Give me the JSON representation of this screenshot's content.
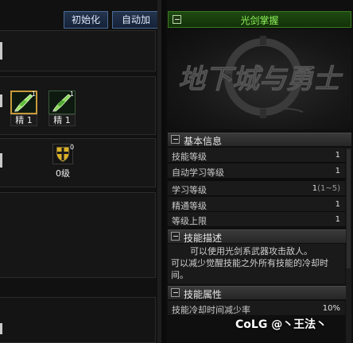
{
  "toolbar": {
    "init_label": "初始化",
    "auto_label": "自动加点"
  },
  "left": {
    "skill_slots": [
      {
        "level_badge": "1",
        "caption": "精 1",
        "icon": "green-sword-skill-icon",
        "selected": true
      },
      {
        "level_badge": "1",
        "caption": "精 1",
        "icon": "green-sword-skill-icon",
        "selected": false
      }
    ],
    "passive_slot": {
      "level_badge": "0",
      "caption": "0级",
      "icon": "shield-cross-icon"
    }
  },
  "detail": {
    "skill_name": "光剑掌握",
    "art_caption": "地下城与勇士",
    "basic_section": "基本信息",
    "rows": [
      {
        "label": "技能等级",
        "value": "1"
      },
      {
        "label": "自动学习等级",
        "value": "1"
      },
      {
        "label": "学习等级",
        "value": "1",
        "range": "(1~5)"
      },
      {
        "label": "精通等级",
        "value": "1"
      },
      {
        "label": "等级上限",
        "value": "1"
      }
    ],
    "desc_section": "技能描述",
    "description": [
      "可以使用光剑系武器攻击敌人。",
      "可以减少觉醒技能之外所有技能的冷却时间。"
    ],
    "attr_section": "技能属性",
    "attributes": [
      {
        "label": "技能冷却时间减少率",
        "value": "10%"
      }
    ]
  },
  "watermark": {
    "logo": "CoLG",
    "handle": "@丶王法丶"
  },
  "colors": {
    "title_green": "#8ff25a",
    "button_blue": "#24344d",
    "selected_gold": "#c79a3a"
  }
}
